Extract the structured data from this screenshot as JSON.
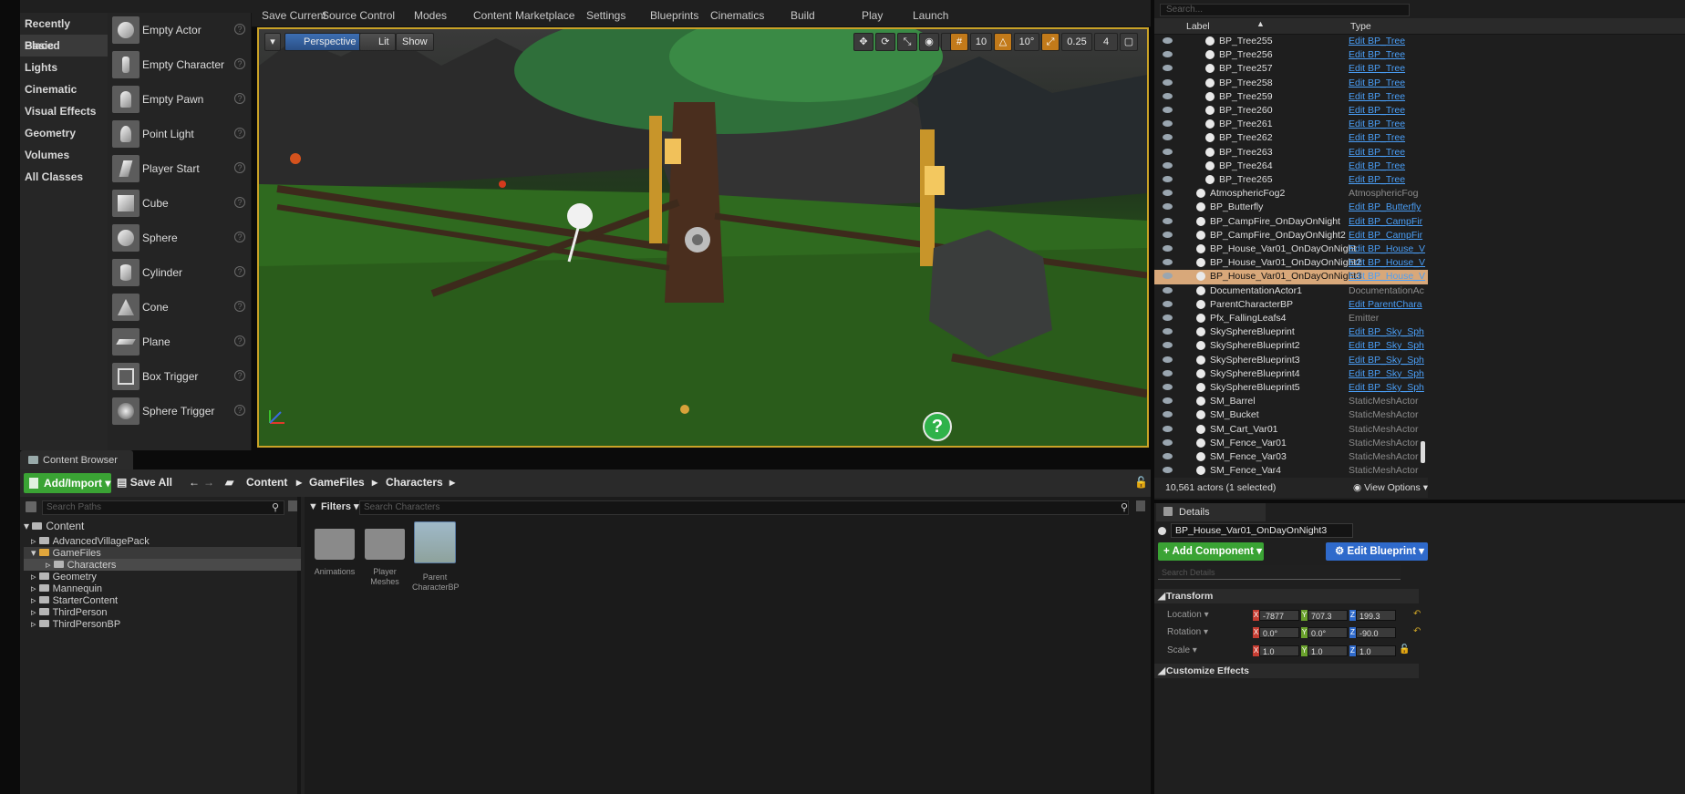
{
  "toolbar": {
    "items": [
      "Save Current",
      "Source Control",
      "Modes",
      "Content",
      "Marketplace",
      "Settings",
      "Blueprints",
      "Cinematics",
      "Build",
      "Play",
      "Launch"
    ]
  },
  "modes": {
    "categories": [
      "Recently Placed",
      "Basic",
      "Lights",
      "Cinematic",
      "Visual Effects",
      "Geometry",
      "Volumes",
      "All Classes"
    ],
    "active_category": "Basic",
    "placeables": [
      "Empty Actor",
      "Empty Character",
      "Empty Pawn",
      "Point Light",
      "Player Start",
      "Cube",
      "Sphere",
      "Cylinder",
      "Cone",
      "Plane",
      "Box Trigger",
      "Sphere Trigger"
    ],
    "help_glyph": "?"
  },
  "viewport": {
    "perspective": "Perspective",
    "lit": "Lit",
    "show": "Show",
    "snap_translate": "10",
    "snap_rotate": "10°",
    "snap_scale": "0.25",
    "camera_speed": "4",
    "help_glyph": "?"
  },
  "content_browser": {
    "tab": "Content Browser",
    "add_import": "Add/Import",
    "save_all": "Save All",
    "breadcrumb": [
      "Content",
      "GameFiles",
      "Characters"
    ],
    "search_paths_placeholder": "Search Paths",
    "filters": "Filters",
    "search_assets_placeholder": "Search Characters",
    "tree": [
      {
        "label": "Content",
        "depth": 0
      },
      {
        "label": "AdvancedVillagePack",
        "depth": 1
      },
      {
        "label": "GameFiles",
        "depth": 1
      },
      {
        "label": "Characters",
        "depth": 2
      },
      {
        "label": "Geometry",
        "depth": 1
      },
      {
        "label": "Mannequin",
        "depth": 1
      },
      {
        "label": "StarterContent",
        "depth": 1
      },
      {
        "label": "ThirdPerson",
        "depth": 1
      },
      {
        "label": "ThirdPersonBP",
        "depth": 1
      }
    ],
    "assets": [
      {
        "line1": "Animations",
        "line2": ""
      },
      {
        "line1": "Player",
        "line2": "Meshes"
      },
      {
        "line1": "Parent",
        "line2": "CharacterBP"
      }
    ]
  },
  "outliner": {
    "search_placeholder": "Search...",
    "col_label": "Label",
    "col_type": "Type",
    "rows": [
      {
        "label": "BP_Tree255",
        "type": "Edit BP_Tree",
        "link": true,
        "indent": 1
      },
      {
        "label": "BP_Tree256",
        "type": "Edit BP_Tree",
        "link": true,
        "indent": 1
      },
      {
        "label": "BP_Tree257",
        "type": "Edit BP_Tree",
        "link": true,
        "indent": 1
      },
      {
        "label": "BP_Tree258",
        "type": "Edit BP_Tree",
        "link": true,
        "indent": 1
      },
      {
        "label": "BP_Tree259",
        "type": "Edit BP_Tree",
        "link": true,
        "indent": 1
      },
      {
        "label": "BP_Tree260",
        "type": "Edit BP_Tree",
        "link": true,
        "indent": 1
      },
      {
        "label": "BP_Tree261",
        "type": "Edit BP_Tree",
        "link": true,
        "indent": 1
      },
      {
        "label": "BP_Tree262",
        "type": "Edit BP_Tree",
        "link": true,
        "indent": 1
      },
      {
        "label": "BP_Tree263",
        "type": "Edit BP_Tree",
        "link": true,
        "indent": 1
      },
      {
        "label": "BP_Tree264",
        "type": "Edit BP_Tree",
        "link": true,
        "indent": 1
      },
      {
        "label": "BP_Tree265",
        "type": "Edit BP_Tree",
        "link": true,
        "indent": 1
      },
      {
        "label": "AtmosphericFog2",
        "type": "AtmosphericFog",
        "link": false,
        "indent": 0
      },
      {
        "label": "BP_Butterfly",
        "type": "Edit BP_Butterfly",
        "link": true,
        "indent": 0
      },
      {
        "label": "BP_CampFire_OnDayOnNight",
        "type": "Edit BP_CampFir",
        "link": true,
        "indent": 0
      },
      {
        "label": "BP_CampFire_OnDayOnNight2",
        "type": "Edit BP_CampFir",
        "link": true,
        "indent": 0
      },
      {
        "label": "BP_House_Var01_OnDayOnNight",
        "type": "Edit BP_House_V",
        "link": true,
        "indent": 0
      },
      {
        "label": "BP_House_Var01_OnDayOnNight2",
        "type": "Edit BP_House_V",
        "link": true,
        "indent": 0
      },
      {
        "label": "BP_House_Var01_OnDayOnNight3",
        "type": "Edit BP_House_V",
        "link": true,
        "indent": 0,
        "selected": true
      },
      {
        "label": "DocumentationActor1",
        "type": "DocumentationAc",
        "link": false,
        "indent": 0
      },
      {
        "label": "ParentCharacterBP",
        "type": "Edit ParentChara",
        "link": true,
        "indent": 0
      },
      {
        "label": "Pfx_FallingLeafs4",
        "type": "Emitter",
        "link": false,
        "indent": 0
      },
      {
        "label": "SkySphereBlueprint",
        "type": "Edit BP_Sky_Sph",
        "link": true,
        "indent": 0
      },
      {
        "label": "SkySphereBlueprint2",
        "type": "Edit BP_Sky_Sph",
        "link": true,
        "indent": 0
      },
      {
        "label": "SkySphereBlueprint3",
        "type": "Edit BP_Sky_Sph",
        "link": true,
        "indent": 0
      },
      {
        "label": "SkySphereBlueprint4",
        "type": "Edit BP_Sky_Sph",
        "link": true,
        "indent": 0
      },
      {
        "label": "SkySphereBlueprint5",
        "type": "Edit BP_Sky_Sph",
        "link": true,
        "indent": 0
      },
      {
        "label": "SM_Barrel",
        "type": "StaticMeshActor",
        "link": false,
        "indent": 0
      },
      {
        "label": "SM_Bucket",
        "type": "StaticMeshActor",
        "link": false,
        "indent": 0
      },
      {
        "label": "SM_Cart_Var01",
        "type": "StaticMeshActor",
        "link": false,
        "indent": 0
      },
      {
        "label": "SM_Fence_Var01",
        "type": "StaticMeshActor",
        "link": false,
        "indent": 0
      },
      {
        "label": "SM_Fence_Var03",
        "type": "StaticMeshActor",
        "link": false,
        "indent": 0
      },
      {
        "label": "SM_Fence_Var4",
        "type": "StaticMeshActor",
        "link": false,
        "indent": 0
      }
    ],
    "footer_count": "10,561 actors (1 selected)",
    "view_options": "View Options"
  },
  "details": {
    "tab": "Details",
    "actor_name": "BP_House_Var01_OnDayOnNight3",
    "add_component": "+ Add Component",
    "edit_blueprint": "Edit Blueprint",
    "search_placeholder": "Search Details",
    "transform_header": "Transform",
    "location_label": "Location",
    "rotation_label": "Rotation",
    "scale_label": "Scale",
    "location": {
      "x": "-7877",
      "y": "707.3",
      "z": "199.3"
    },
    "rotation": {
      "x": "0.0°",
      "y": "0.0°",
      "z": "-90.0"
    },
    "scale": {
      "x": "1.0",
      "y": "1.0",
      "z": "1.0"
    },
    "customize_header": "Customize Effects"
  },
  "colors": {
    "accent_orange": "#c9a227",
    "add_green": "#3aa334",
    "edit_blue": "#2f6acb",
    "link_blue": "#4a9ef6",
    "selection": "#d8a87a"
  }
}
